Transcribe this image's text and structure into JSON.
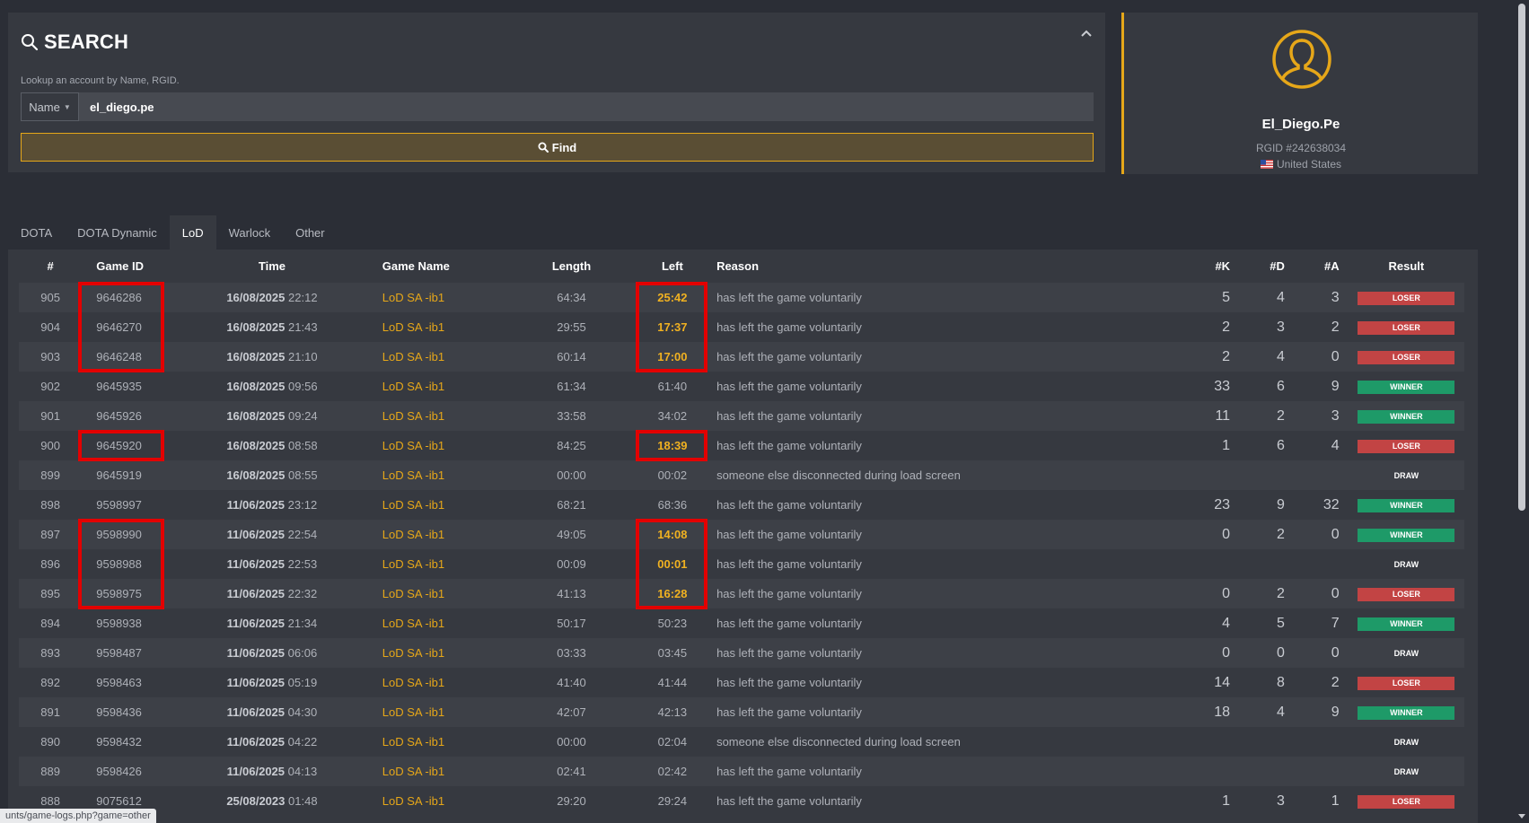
{
  "search": {
    "title": "SEARCH",
    "subtitle": "Lookup an account by Name, RGID.",
    "type_label": "Name",
    "query_value": "el_diego.pe",
    "find_label": "Find"
  },
  "profile": {
    "name": "El_Diego.Pe",
    "rgid": "RGID #242638034",
    "country": "United States"
  },
  "tabs": [
    {
      "label": "DOTA"
    },
    {
      "label": "DOTA Dynamic"
    },
    {
      "label": "LoD"
    },
    {
      "label": "Warlock"
    },
    {
      "label": "Other"
    }
  ],
  "active_tab": "LoD",
  "table": {
    "headers": [
      "#",
      "Game ID",
      "Time",
      "Game Name",
      "Length",
      "Left",
      "Reason",
      "#K",
      "#D",
      "#A",
      "Result"
    ],
    "rows": [
      {
        "num": "905",
        "game_id": "9646286",
        "date": "16/08/2025",
        "clock": "22:12",
        "game_name": "LoD SA -ib1",
        "length": "64:34",
        "left": "25:42",
        "reason": "has left the game voluntarily",
        "k": "5",
        "d": "4",
        "a": "3",
        "result": "LOSER"
      },
      {
        "num": "904",
        "game_id": "9646270",
        "date": "16/08/2025",
        "clock": "21:43",
        "game_name": "LoD SA -ib1",
        "length": "29:55",
        "left": "17:37",
        "reason": "has left the game voluntarily",
        "k": "2",
        "d": "3",
        "a": "2",
        "result": "LOSER"
      },
      {
        "num": "903",
        "game_id": "9646248",
        "date": "16/08/2025",
        "clock": "21:10",
        "game_name": "LoD SA -ib1",
        "length": "60:14",
        "left": "17:00",
        "reason": "has left the game voluntarily",
        "k": "2",
        "d": "4",
        "a": "0",
        "result": "LOSER"
      },
      {
        "num": "902",
        "game_id": "9645935",
        "date": "16/08/2025",
        "clock": "09:56",
        "game_name": "LoD SA -ib1",
        "length": "61:34",
        "left": "61:40",
        "reason": "has left the game voluntarily",
        "k": "33",
        "d": "6",
        "a": "9",
        "result": "WINNER"
      },
      {
        "num": "901",
        "game_id": "9645926",
        "date": "16/08/2025",
        "clock": "09:24",
        "game_name": "LoD SA -ib1",
        "length": "33:58",
        "left": "34:02",
        "reason": "has left the game voluntarily",
        "k": "11",
        "d": "2",
        "a": "3",
        "result": "WINNER"
      },
      {
        "num": "900",
        "game_id": "9645920",
        "date": "16/08/2025",
        "clock": "08:58",
        "game_name": "LoD SA -ib1",
        "length": "84:25",
        "left": "18:39",
        "reason": "has left the game voluntarily",
        "k": "1",
        "d": "6",
        "a": "4",
        "result": "LOSER"
      },
      {
        "num": "899",
        "game_id": "9645919",
        "date": "16/08/2025",
        "clock": "08:55",
        "game_name": "LoD SA -ib1",
        "length": "00:00",
        "left": "00:02",
        "reason": "someone else disconnected during load screen",
        "k": "",
        "d": "",
        "a": "",
        "result": "DRAW"
      },
      {
        "num": "898",
        "game_id": "9598997",
        "date": "11/06/2025",
        "clock": "23:12",
        "game_name": "LoD SA -ib1",
        "length": "68:21",
        "left": "68:36",
        "reason": "has left the game voluntarily",
        "k": "23",
        "d": "9",
        "a": "32",
        "result": "WINNER"
      },
      {
        "num": "897",
        "game_id": "9598990",
        "date": "11/06/2025",
        "clock": "22:54",
        "game_name": "LoD SA -ib1",
        "length": "49:05",
        "left": "14:08",
        "reason": "has left the game voluntarily",
        "k": "0",
        "d": "2",
        "a": "0",
        "result": "WINNER"
      },
      {
        "num": "896",
        "game_id": "9598988",
        "date": "11/06/2025",
        "clock": "22:53",
        "game_name": "LoD SA -ib1",
        "length": "00:09",
        "left": "00:01",
        "reason": "has left the game voluntarily",
        "k": "",
        "d": "",
        "a": "",
        "result": "DRAW"
      },
      {
        "num": "895",
        "game_id": "9598975",
        "date": "11/06/2025",
        "clock": "22:32",
        "game_name": "LoD SA -ib1",
        "length": "41:13",
        "left": "16:28",
        "reason": "has left the game voluntarily",
        "k": "0",
        "d": "2",
        "a": "0",
        "result": "LOSER"
      },
      {
        "num": "894",
        "game_id": "9598938",
        "date": "11/06/2025",
        "clock": "21:34",
        "game_name": "LoD SA -ib1",
        "length": "50:17",
        "left": "50:23",
        "reason": "has left the game voluntarily",
        "k": "4",
        "d": "5",
        "a": "7",
        "result": "WINNER"
      },
      {
        "num": "893",
        "game_id": "9598487",
        "date": "11/06/2025",
        "clock": "06:06",
        "game_name": "LoD SA -ib1",
        "length": "03:33",
        "left": "03:45",
        "reason": "has left the game voluntarily",
        "k": "0",
        "d": "0",
        "a": "0",
        "result": "DRAW"
      },
      {
        "num": "892",
        "game_id": "9598463",
        "date": "11/06/2025",
        "clock": "05:19",
        "game_name": "LoD SA -ib1",
        "length": "41:40",
        "left": "41:44",
        "reason": "has left the game voluntarily",
        "k": "14",
        "d": "8",
        "a": "2",
        "result": "LOSER"
      },
      {
        "num": "891",
        "game_id": "9598436",
        "date": "11/06/2025",
        "clock": "04:30",
        "game_name": "LoD SA -ib1",
        "length": "42:07",
        "left": "42:13",
        "reason": "has left the game voluntarily",
        "k": "18",
        "d": "4",
        "a": "9",
        "result": "WINNER"
      },
      {
        "num": "890",
        "game_id": "9598432",
        "date": "11/06/2025",
        "clock": "04:22",
        "game_name": "LoD SA -ib1",
        "length": "00:00",
        "left": "02:04",
        "reason": "someone else disconnected during load screen",
        "k": "",
        "d": "",
        "a": "",
        "result": "DRAW"
      },
      {
        "num": "889",
        "game_id": "9598426",
        "date": "11/06/2025",
        "clock": "04:13",
        "game_name": "LoD SA -ib1",
        "length": "02:41",
        "left": "02:42",
        "reason": "has left the game voluntarily",
        "k": "",
        "d": "",
        "a": "",
        "result": "DRAW"
      },
      {
        "num": "888",
        "game_id": "9075612",
        "date": "25/08/2023",
        "clock": "01:48",
        "game_name": "LoD SA -ib1",
        "length": "29:20",
        "left": "29:24",
        "reason": "has left the game voluntarily",
        "k": "1",
        "d": "3",
        "a": "1",
        "result": "LOSER"
      }
    ],
    "highlighted_left_rows": [
      0,
      1,
      2,
      5,
      8,
      9,
      10
    ]
  },
  "status_bar_url": "unts/game-logs.php?game=other",
  "colors": {
    "accent": "#e6a719",
    "loser": "#c24444",
    "winner": "#1e9a68",
    "annotation": "#e30000"
  }
}
